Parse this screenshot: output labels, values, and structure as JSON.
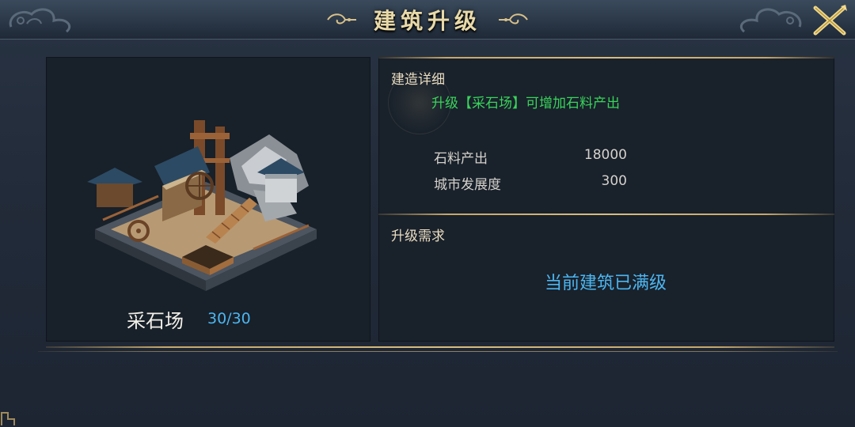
{
  "header": {
    "title": "建筑升级"
  },
  "building": {
    "name": "采石场",
    "level": "30/30"
  },
  "details": {
    "section_label": "建造详细",
    "description": "升级【采石场】可增加石料产出",
    "stats": [
      {
        "name": "石料产出",
        "value": "18000"
      },
      {
        "name": "城市发展度",
        "value": "300"
      }
    ]
  },
  "requirements": {
    "section_label": "升级需求",
    "status": "当前建筑已满级"
  },
  "colors": {
    "gold": "#c6a76a",
    "green_text": "#38d45a",
    "blue_text": "#4cb6f0",
    "title_text": "#e8d9a8"
  },
  "icons": [
    "close-icon",
    "cloud-ornament-icon",
    "title-ornament-icon",
    "quarry-building-icon"
  ]
}
